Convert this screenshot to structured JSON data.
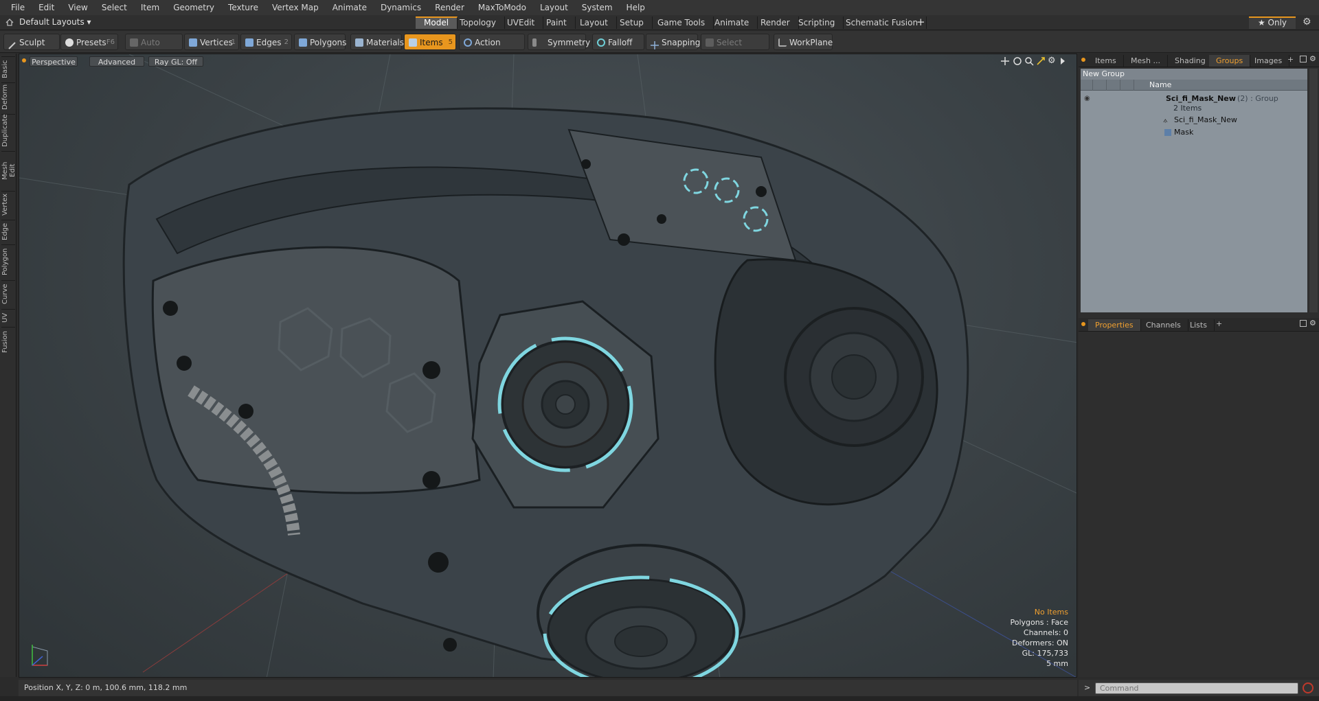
{
  "menu": [
    "File",
    "Edit",
    "View",
    "Select",
    "Item",
    "Geometry",
    "Texture",
    "Vertex Map",
    "Animate",
    "Dynamics",
    "Render",
    "MaxToModo",
    "Layout",
    "System",
    "Help"
  ],
  "layout": {
    "dropdown": "Default Layouts ▾",
    "tabs": [
      "Model",
      "Topology",
      "UVEdit",
      "Paint",
      "Layout",
      "Setup",
      "Game Tools",
      "Animate",
      "Render",
      "Scripting",
      "Schematic Fusion"
    ],
    "active_tab": "Model",
    "add": "+",
    "only_label": "★ Only",
    "gear": "⚙"
  },
  "toolbar": {
    "sculpt": "Sculpt",
    "presets": "Presets",
    "presets_key": "F6",
    "auto_select": "Auto Select",
    "vertices": "Vertices",
    "vertices_key": "1",
    "edges": "Edges",
    "edges_key": "2",
    "polygons": "Polygons",
    "materials": "Materials",
    "items": "Items",
    "items_key": "5",
    "action_center": "Action Center",
    "symmetry": "Symmetry",
    "falloff": "Falloff",
    "snapping": "Snapping",
    "select_through": "Select Through",
    "workplane": "WorkPlane"
  },
  "left_tabs": [
    "Basic",
    "Deform",
    "Duplicate",
    "Mesh Edit",
    "Vertex",
    "Edge",
    "Polygon",
    "Curve",
    "UV",
    "Fusion"
  ],
  "viewport": {
    "view": "Perspective",
    "shading": "Advanced",
    "raygl": "Ray GL: Off",
    "info": {
      "items": "No Items",
      "polygons": "Polygons : Face",
      "channels": "Channels: 0",
      "deformers": "Deformers: ON",
      "gl": "GL: 175,733",
      "scale": "5 mm"
    }
  },
  "panel_top": {
    "tabs": [
      "Items",
      "Mesh ...",
      "Shading",
      "Groups",
      "Images"
    ],
    "active": "Groups",
    "add": "+",
    "new_group": "New Group",
    "name_header": "Name",
    "tree": {
      "group_name": "Sci_fi_Mask_New",
      "group_suffix": "(2) : Group",
      "group_count": "2 Items",
      "child1": "Sci_fi_Mask_New",
      "child2": "Mask"
    }
  },
  "panel_bottom": {
    "tabs": [
      "Properties",
      "Channels",
      "Lists"
    ],
    "active": "Properties",
    "add": "+"
  },
  "status": {
    "position": "Position X, Y, Z:  0 m, 100.6 mm, 118.2 mm",
    "command_placeholder": "Command"
  },
  "colors": {
    "accent": "#e8961e",
    "glow": "#7fd6e0",
    "mask_body": "#3b4349"
  }
}
